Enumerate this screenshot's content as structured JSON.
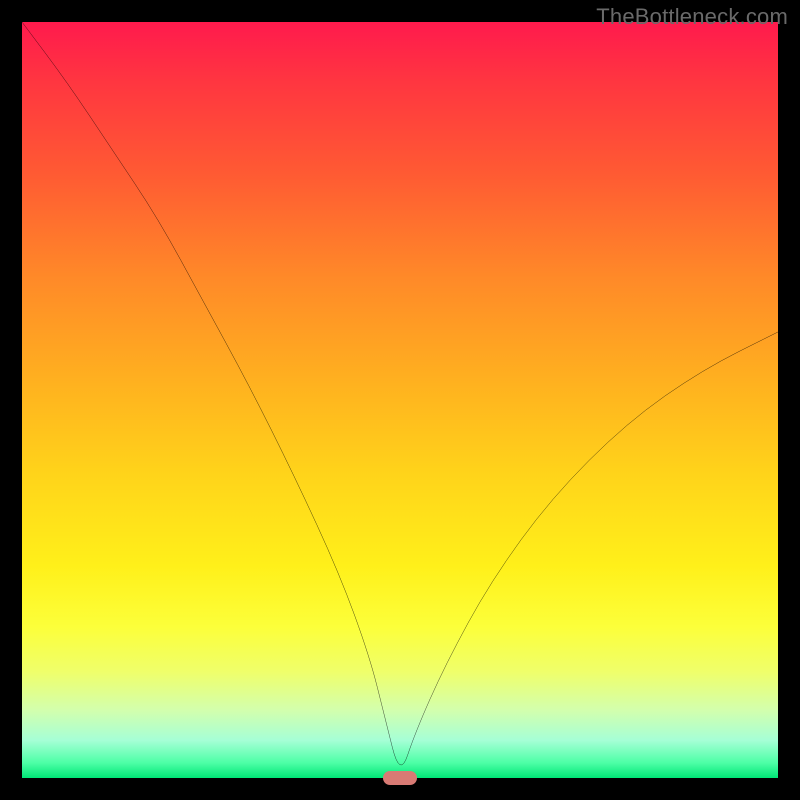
{
  "watermark": "TheBottleneck.com",
  "colors": {
    "frame": "#000000",
    "curve": "#000000",
    "minpoint": "#d87a74"
  },
  "chart_data": {
    "type": "line",
    "title": "",
    "xlabel": "",
    "ylabel": "",
    "xlim": [
      0,
      100
    ],
    "ylim": [
      0,
      100
    ],
    "grid": false,
    "legend": false,
    "annotations": [
      {
        "name": "minimum-marker",
        "x": 50,
        "y": 0
      }
    ],
    "series": [
      {
        "name": "bottleneck-curve",
        "x": [
          0,
          6,
          12,
          18,
          24,
          30,
          36,
          42,
          46,
          48,
          50,
          52,
          56,
          62,
          70,
          80,
          90,
          100
        ],
        "y": [
          100,
          92,
          83,
          74,
          63,
          52,
          40,
          27,
          16,
          8,
          0,
          6,
          15,
          26,
          37,
          47,
          54,
          59
        ]
      }
    ],
    "background_gradient": {
      "direction": "top-to-bottom",
      "stops": [
        {
          "pos": 0.0,
          "color": "#ff1a4d"
        },
        {
          "pos": 0.5,
          "color": "#ffd41a"
        },
        {
          "pos": 0.85,
          "color": "#fcff3a"
        },
        {
          "pos": 1.0,
          "color": "#00e676"
        }
      ]
    }
  }
}
